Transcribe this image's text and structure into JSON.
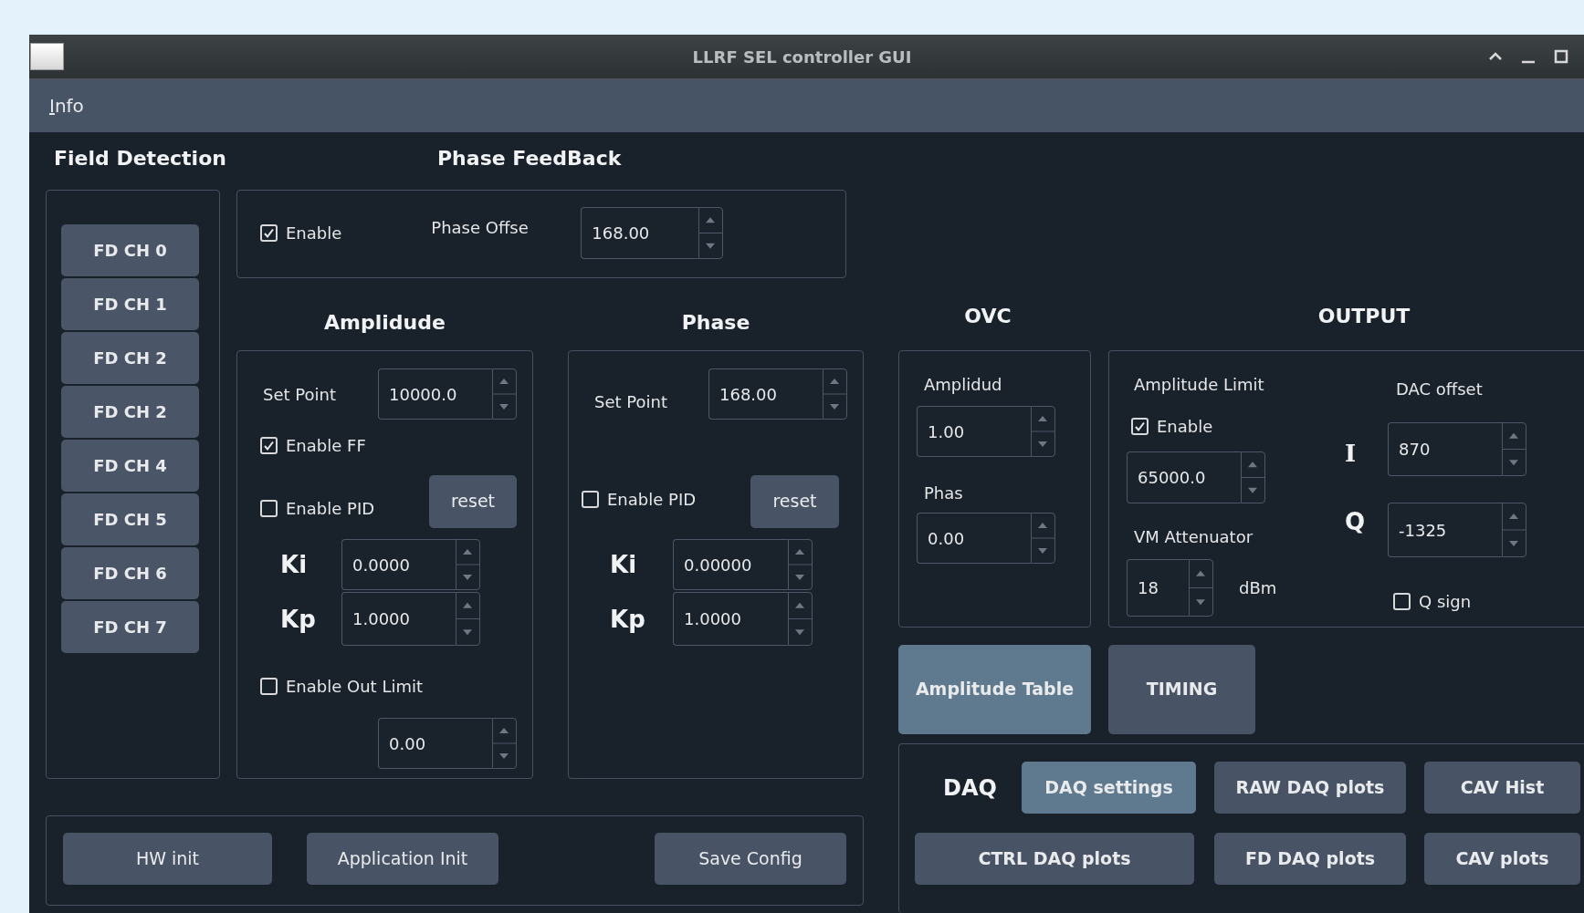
{
  "window": {
    "title": "LLRF SEL controller GUI"
  },
  "menu": [
    {
      "label": "Info"
    }
  ],
  "field_detection": {
    "title": "Field Detection",
    "channels": [
      "FD CH 0",
      "FD CH 1",
      "FD CH 2",
      "FD CH 2",
      "FD CH 4",
      "FD CH 5",
      "FD CH 6",
      "FD CH 7"
    ]
  },
  "phase_feedback": {
    "title": "Phase FeedBack",
    "enable": {
      "label": "Enable",
      "checked": true
    },
    "offset": {
      "label": "Phase Offse",
      "value": "168.00"
    }
  },
  "amplitude": {
    "title": "Amplidude",
    "set_point": {
      "label": "Set Point",
      "value": "10000.0"
    },
    "enable_ff": {
      "label": "Enable FF",
      "checked": true
    },
    "enable_pid": {
      "label": "Enable PID",
      "checked": false
    },
    "reset": "reset",
    "ki": {
      "label": "Ki",
      "value": "0.0000"
    },
    "kp": {
      "label": "Kp",
      "value": "1.0000"
    },
    "enable_out_limit": {
      "label": "Enable Out Limit",
      "checked": false
    },
    "out_limit": {
      "value": "0.00"
    }
  },
  "phase": {
    "title": "Phase",
    "set_point": {
      "label": "Set Point",
      "value": "168.00"
    },
    "enable_pid": {
      "label": "Enable PID",
      "checked": false
    },
    "reset": "reset",
    "ki": {
      "label": "Ki",
      "value": "0.00000"
    },
    "kp": {
      "label": "Kp",
      "value": "1.0000"
    }
  },
  "ovc": {
    "title": "OVC",
    "amplitude": {
      "label": "Amplidud",
      "value": "1.00"
    },
    "phase": {
      "label": "Phas",
      "value": "0.00"
    }
  },
  "output": {
    "title": "OUTPUT",
    "amplitude_limit": {
      "label": "Amplitude Limit",
      "enable": {
        "label": "Enable",
        "checked": true
      },
      "value": "65000.0"
    },
    "vm_attenuator": {
      "label": "VM Attenuator",
      "value": "18",
      "unit": "dBm"
    },
    "dac_offset": {
      "label": "DAC offset",
      "i": {
        "label": "I",
        "value": "870"
      },
      "q": {
        "label": "Q",
        "value": "-1325"
      }
    },
    "q_sign": {
      "label": "Q sign",
      "checked": false
    }
  },
  "mode_buttons": [
    {
      "label": "Amplitude Table",
      "active": true
    },
    {
      "label": "TIMING",
      "active": false
    }
  ],
  "daq": {
    "title": "DAQ",
    "buttons": [
      {
        "label": "DAQ settings",
        "active": true
      },
      {
        "label": "RAW DAQ plots",
        "active": false
      },
      {
        "label": "CAV Hist",
        "active": false
      },
      {
        "label": "CTRL DAQ plots",
        "active": false
      },
      {
        "label": "FD DAQ plots",
        "active": false
      },
      {
        "label": "CAV plots",
        "active": false
      }
    ]
  },
  "bottom_buttons": [
    {
      "label": "HW init"
    },
    {
      "label": "Application Init"
    },
    {
      "label": "Save Config"
    }
  ]
}
